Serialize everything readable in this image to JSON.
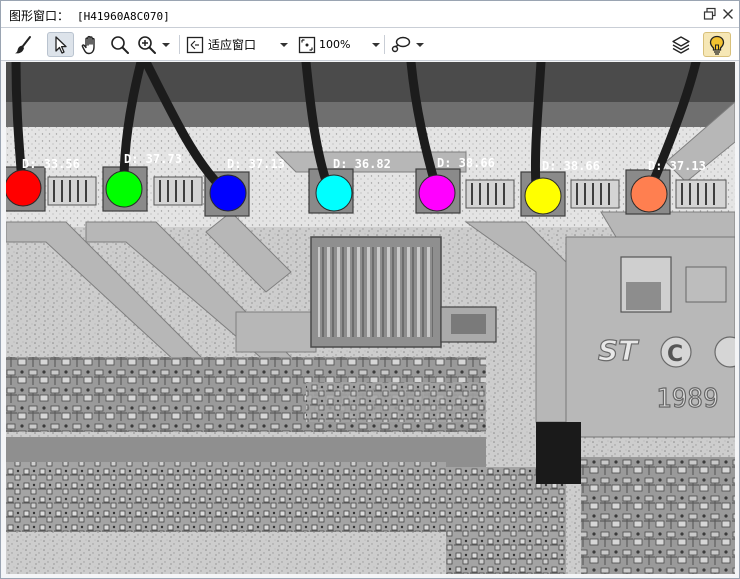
{
  "window": {
    "title": "图形窗口：",
    "window_id": "[H41960A8C070]",
    "restore_icon": "restore-window-icon",
    "close_icon": "close-icon"
  },
  "toolbar": {
    "tools": [
      {
        "name": "brush-tool",
        "icon": "brush-icon"
      },
      {
        "name": "select-tool",
        "icon": "pointer-icon",
        "active": true
      },
      {
        "name": "pan-tool",
        "icon": "hand-icon"
      },
      {
        "name": "zoom-tool",
        "icon": "magnifier-icon"
      },
      {
        "name": "zoom-in-tool",
        "icon": "zoom-in-icon"
      }
    ],
    "fit_mode_label": "适应窗口",
    "zoom_label": "100%",
    "roi_icon": "lasso-icon",
    "layers_icon": "layers-icon",
    "hint_icon": "lightbulb-icon"
  },
  "image": {
    "markers": [
      {
        "label": "D: 33.56",
        "color": "#ff0000"
      },
      {
        "label": "D: 37.73",
        "color": "#00ff00"
      },
      {
        "label": "D: 37.13",
        "color": "#0000ff"
      },
      {
        "label": "D: 36.82",
        "color": "#00ffff"
      },
      {
        "label": "D: 38.66",
        "color": "#ff00ff"
      },
      {
        "label": "D: 38.66",
        "color": "#ffff00"
      },
      {
        "label": "D: 37.13",
        "color": "#ff7f50"
      }
    ],
    "chip_marking_logo": "ST",
    "chip_marking_c": "C",
    "chip_year": "1989"
  }
}
